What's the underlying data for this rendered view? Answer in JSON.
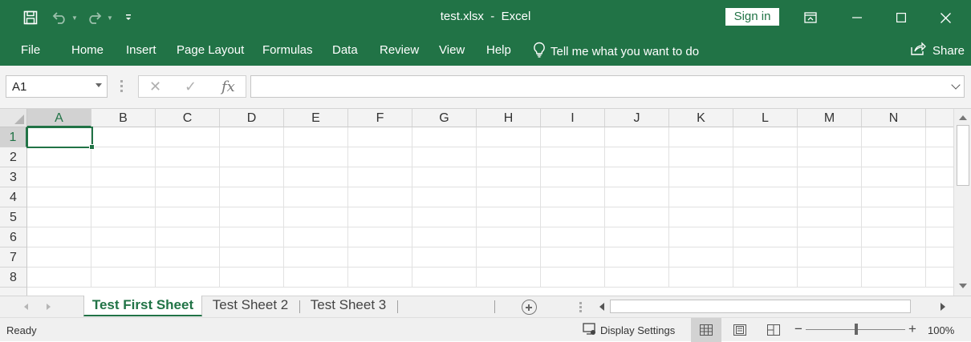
{
  "titlebar": {
    "filename": "test.xlsx",
    "separator": "-",
    "app": "Excel",
    "sign_in": "Sign in"
  },
  "ribbon": {
    "tabs": [
      "File",
      "Home",
      "Insert",
      "Page Layout",
      "Formulas",
      "Data",
      "Review",
      "View",
      "Help"
    ],
    "tell_me": "Tell me what you want to do",
    "share": "Share"
  },
  "formula_bar": {
    "name_box": "A1",
    "cancel_glyph": "✕",
    "enter_glyph": "✓",
    "fx_label": "fx",
    "formula_value": ""
  },
  "sheet": {
    "columns": [
      "A",
      "B",
      "C",
      "D",
      "E",
      "F",
      "G",
      "H",
      "I",
      "J",
      "K",
      "L",
      "M",
      "N"
    ],
    "rows": [
      "1",
      "2",
      "3",
      "4",
      "5",
      "6",
      "7",
      "8"
    ],
    "selected_cell": "A1"
  },
  "sheet_tabs": {
    "tabs": [
      "Test First Sheet",
      "Test Sheet 2",
      "Test Sheet 3"
    ],
    "active": "Test First Sheet"
  },
  "statusbar": {
    "status": "Ready",
    "display_settings": "Display Settings",
    "zoom_minus": "−",
    "zoom_plus": "+",
    "zoom": "100%"
  },
  "colors": {
    "brand": "#217346"
  }
}
